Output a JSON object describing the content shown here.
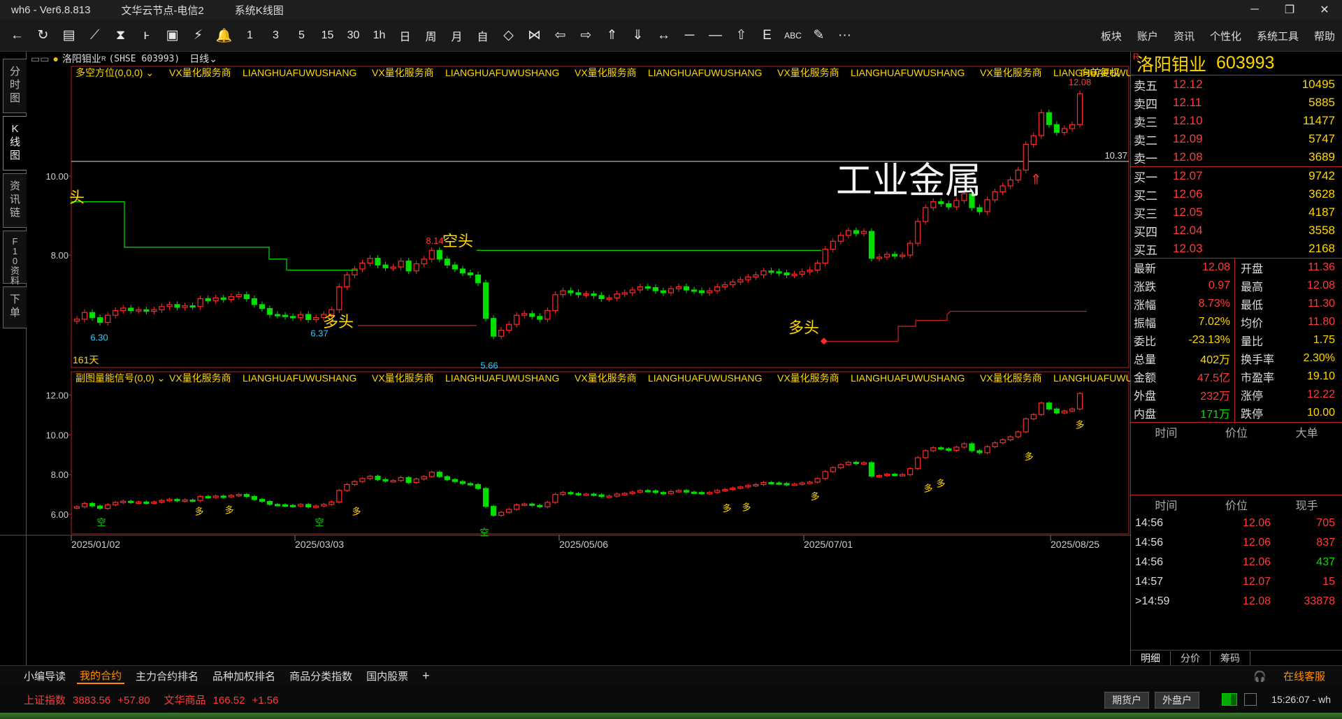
{
  "window": {
    "title": "wh6  -  Ver6.8.813",
    "server": "文华云节点-电信2",
    "view": "系统K线图",
    "controls": [
      "─",
      "❐",
      "✕"
    ]
  },
  "toolbar": {
    "icons": [
      "back-arrow-icon",
      "refresh-icon",
      "table-icon",
      "line-chart-icon",
      "candle-icon",
      "k-icon",
      "screen-icon",
      "lightning-icon",
      "bell-icon",
      "period-1",
      "period-3",
      "period-5",
      "period-15",
      "period-30",
      "period-1h",
      "period-day",
      "period-week",
      "period-month",
      "self-select",
      "shrink-icon",
      "expand-icon",
      "prev-icon",
      "next-icon",
      "up-icon",
      "down-icon",
      "crosshair-icon",
      "hline-icon",
      "minus-icon",
      "home-icon",
      "e-icon",
      "abc-icon",
      "pen-icon",
      "more-icon"
    ],
    "glyphs": [
      "←",
      "↻",
      "▤",
      "⟋",
      "⧗",
      "ⱶ",
      "▣",
      "⚡",
      "🔔",
      "1",
      "3",
      "5",
      "15",
      "30",
      "1h",
      "日",
      "周",
      "月",
      "自",
      "◇",
      "⋈",
      "⇦",
      "⇨",
      "⇑",
      "⇓",
      "↔",
      "─",
      "—",
      "⇧",
      "E",
      "ABC",
      "✎",
      "···"
    ],
    "menus": [
      "板块",
      "账户",
      "资讯",
      "个性化",
      "系统工具",
      "帮助"
    ]
  },
  "sidetabs": [
    "分\n时\n图",
    "K\n线\n图",
    "资\n讯\n链",
    "F\n1\n0\n资\n料",
    "下\n单"
  ],
  "chart_header": {
    "symbol": "洛阳钼业",
    "sup": "R",
    "code": "(SHSE 603993)",
    "period": "日线"
  },
  "main_indicator": {
    "label": "多空方位(0,0,0)",
    "watermark_items": [
      "VX量化服务商",
      "LIANGHUAFUWUSHANG",
      "VX量化服务商",
      "LIANGHUAFUWUSHANG",
      "VX量化服务商",
      "LIANGHUAFUWUSHANG",
      "VX量化服务商",
      "LIANGHUAFUWUSHANG",
      "VX量化服务商",
      "LIANGHUAFUWUSHANG"
    ],
    "adjust_label": "向前复权",
    "days_label": "161天",
    "annotation_big": "工业金属",
    "labels": {
      "kong": "空头",
      "duo1": "多头",
      "duo2": "多头",
      "tou": "头"
    },
    "price_marks": {
      "high": "12.08",
      "peak": "8.14",
      "low1": "6.30",
      "low2": "6.37",
      "low3": "5.66",
      "hline": "10.37"
    },
    "y_ticks": [
      "10.00",
      "8.00"
    ]
  },
  "sub_indicator": {
    "label": "副图量能信号(0,0)",
    "watermark_items": [
      "VX量化服务商",
      "LIANGHUAFUWUSHANG",
      "VX量化服务商",
      "LIANGHUAFUWUSHANG",
      "VX量化服务商",
      "LIANGHUAFUWUSHANG",
      "VX量化服务商",
      "LIANGHUAFUWUSHANG",
      "VX量化服务商",
      "LIANGHUAFUWUSHANG"
    ],
    "y_ticks": [
      "12.00",
      "10.00",
      "8.00",
      "6.00"
    ],
    "signal_duo": "多",
    "signal_kong": "空"
  },
  "x_axis": [
    "2025/01/02",
    "2025/03/03",
    "2025/05/06",
    "2025/07/01",
    "2025/08/25"
  ],
  "quote": {
    "name": "洛阳钼业",
    "code": "603993",
    "r_mark": "R",
    "asks": [
      {
        "label": "卖五",
        "price": "12.12",
        "vol": "10495"
      },
      {
        "label": "卖四",
        "price": "12.11",
        "vol": "5885"
      },
      {
        "label": "卖三",
        "price": "12.10",
        "vol": "11477"
      },
      {
        "label": "卖二",
        "price": "12.09",
        "vol": "5747"
      },
      {
        "label": "卖一",
        "price": "12.08",
        "vol": "3689"
      }
    ],
    "bids": [
      {
        "label": "买一",
        "price": "12.07",
        "vol": "9742"
      },
      {
        "label": "买二",
        "price": "12.06",
        "vol": "3628"
      },
      {
        "label": "买三",
        "price": "12.05",
        "vol": "4187"
      },
      {
        "label": "买四",
        "price": "12.04",
        "vol": "3558"
      },
      {
        "label": "买五",
        "price": "12.03",
        "vol": "2168"
      }
    ],
    "stats": [
      {
        "l1": "最新",
        "v1": "12.08",
        "c1": "red",
        "l2": "开盘",
        "v2": "11.36",
        "c2": "red"
      },
      {
        "l1": "涨跌",
        "v1": "0.97",
        "c1": "red",
        "l2": "最高",
        "v2": "12.08",
        "c2": "red"
      },
      {
        "l1": "涨幅",
        "v1": "8.73%",
        "c1": "red",
        "l2": "最低",
        "v2": "11.30",
        "c2": "red"
      },
      {
        "l1": "振幅",
        "v1": "7.02%",
        "c1": "yel",
        "l2": "均价",
        "v2": "11.80",
        "c2": "red"
      },
      {
        "l1": "委比",
        "v1": "-23.13%",
        "c1": "yel",
        "l2": "量比",
        "v2": "1.75",
        "c2": "yel"
      },
      {
        "l1": "总量",
        "v1": "402万",
        "c1": "yel",
        "l2": "换手率",
        "v2": "2.30%",
        "c2": "yel"
      },
      {
        "l1": "金额",
        "v1": "47.5亿",
        "c1": "red",
        "l2": "市盈率",
        "v2": "19.10",
        "c2": "yel"
      },
      {
        "l1": "外盘",
        "v1": "232万",
        "c1": "red",
        "l2": "涨停",
        "v2": "12.22",
        "c2": "red"
      },
      {
        "l1": "内盘",
        "v1": "171万",
        "c1": "grn",
        "l2": "跌停",
        "v2": "10.00",
        "c2": "yel"
      }
    ],
    "bigorder_header": [
      "时间",
      "价位",
      "大单"
    ],
    "tick_header": [
      "时间",
      "价位",
      "现手"
    ],
    "ticks": [
      {
        "t": "14:56",
        "p": "12.06",
        "v": "705",
        "c": "red"
      },
      {
        "t": "14:56",
        "p": "12.06",
        "v": "837",
        "c": "red"
      },
      {
        "t": "14:56",
        "p": "12.06",
        "v": "437",
        "c": "grn"
      },
      {
        "t": "14:57",
        "p": "12.07",
        "v": "15",
        "c": "red"
      },
      {
        "t": ">14:59",
        "p": "12.08",
        "v": "33878",
        "c": "red"
      }
    ],
    "bottom_tabs": [
      "明细",
      "分价",
      "筹码"
    ]
  },
  "tabbar": {
    "tabs": [
      "小编导读",
      "我的合约",
      "主力合约排名",
      "品种加权排名",
      "商品分类指数",
      "国内股票"
    ],
    "active": "我的合约",
    "add": "+",
    "service": "在线客服"
  },
  "statusbar": {
    "idx1_name": "上证指数",
    "idx1_val": "3883.56",
    "idx1_chg": "+57.80",
    "idx2_name": "文华商品",
    "idx2_val": "166.52",
    "idx2_chg": "+1.56",
    "btn1": "期货户",
    "btn2": "外盘户",
    "clock": "15:26:07 - wh"
  },
  "colors": {
    "up": "#ff2a2a",
    "down": "#00e000",
    "accent": "#ffd700",
    "frame": "#b22222"
  },
  "chart_data": {
    "type": "candlestick",
    "y_range": [
      5.3,
      12.4
    ],
    "closes": [
      6.38,
      6.55,
      6.42,
      6.3,
      6.48,
      6.6,
      6.66,
      6.6,
      6.62,
      6.58,
      6.62,
      6.7,
      6.75,
      6.68,
      6.72,
      6.7,
      6.9,
      6.85,
      6.92,
      6.88,
      6.95,
      7.0,
      6.9,
      6.75,
      6.65,
      6.5,
      6.48,
      6.45,
      6.42,
      6.5,
      6.37,
      6.42,
      6.5,
      6.62,
      7.2,
      7.5,
      7.65,
      7.8,
      7.92,
      7.75,
      7.68,
      7.7,
      7.85,
      7.6,
      7.78,
      7.9,
      8.12,
      7.9,
      7.75,
      7.65,
      7.55,
      7.5,
      7.3,
      6.4,
      5.95,
      6.1,
      6.25,
      6.48,
      6.52,
      6.45,
      6.38,
      6.6,
      7.0,
      7.1,
      7.05,
      7.0,
      7.02,
      6.98,
      6.9,
      6.92,
      7.02,
      7.05,
      7.12,
      7.2,
      7.18,
      7.1,
      7.05,
      7.15,
      7.2,
      7.12,
      7.1,
      7.05,
      7.1,
      7.2,
      7.25,
      7.32,
      7.38,
      7.45,
      7.5,
      7.6,
      7.58,
      7.55,
      7.5,
      7.52,
      7.58,
      7.62,
      7.8,
      8.15,
      8.35,
      8.5,
      8.62,
      8.55,
      8.6,
      7.92,
      7.95,
      8.02,
      7.98,
      8.0,
      8.3,
      8.85,
      9.2,
      9.35,
      9.3,
      9.22,
      9.38,
      9.55,
      9.2,
      9.1,
      9.4,
      9.6,
      9.75,
      9.9,
      10.15,
      10.8,
      11.02,
      11.6,
      11.3,
      11.1,
      11.2,
      11.3,
      12.08
    ]
  }
}
